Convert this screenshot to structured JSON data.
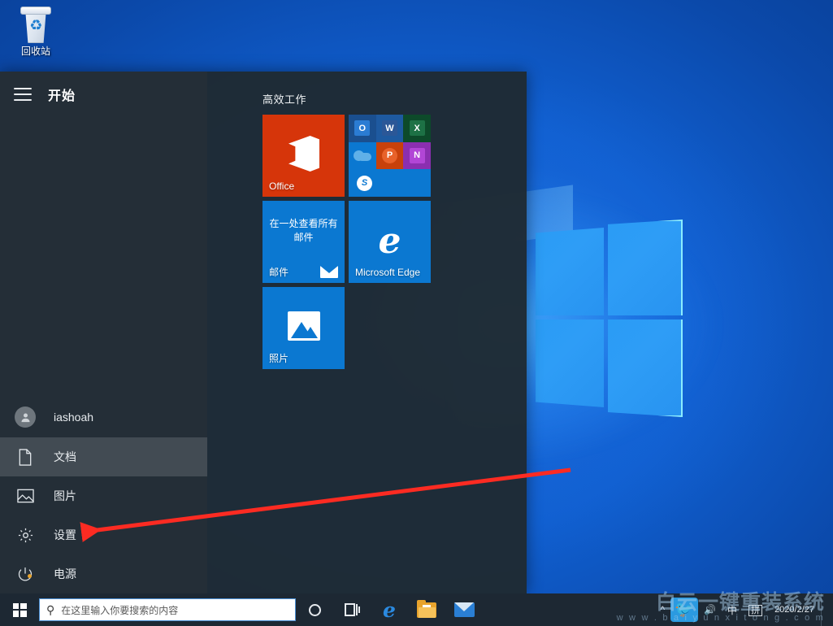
{
  "desktop": {
    "recycle_bin_label": "回收站",
    "recycle_bin_icon": "recycle-bin-icon"
  },
  "start_menu": {
    "hamburger_icon": "hamburger-menu-icon",
    "title": "开始",
    "user": {
      "name": "iashoah",
      "avatar_icon": "user-avatar-icon"
    },
    "rail_items": [
      {
        "label": "文档",
        "icon": "document-icon",
        "selected": true
      },
      {
        "label": "图片",
        "icon": "picture-icon",
        "selected": false
      },
      {
        "label": "设置",
        "icon": "gear-icon",
        "selected": false
      },
      {
        "label": "电源",
        "icon": "power-icon",
        "selected": false
      }
    ],
    "tile_group": {
      "title": "高效工作",
      "tiles": [
        {
          "name": "office",
          "label": "Office",
          "color": "#d6350a"
        },
        {
          "name": "suite",
          "label": "",
          "color": "#0b78d1"
        },
        {
          "name": "mail",
          "label": "邮件",
          "headline": "在一处查看所有邮件",
          "color": "#0b78d1"
        },
        {
          "name": "edge",
          "label": "Microsoft Edge",
          "color": "#0b78d1"
        },
        {
          "name": "photos",
          "label": "照片",
          "color": "#0b78d1"
        }
      ],
      "suite_apps": [
        {
          "key": "O",
          "name": "outlook-icon"
        },
        {
          "key": "W",
          "name": "word-icon"
        },
        {
          "key": "X",
          "name": "excel-icon"
        },
        {
          "key": "",
          "name": "onedrive-icon"
        },
        {
          "key": "P",
          "name": "powerpoint-icon"
        },
        {
          "key": "N",
          "name": "onenote-icon"
        },
        {
          "key": "S",
          "name": "skype-icon"
        }
      ]
    }
  },
  "annotation": {
    "arrow_color": "#fc2b22",
    "points_to": "设置"
  },
  "taskbar": {
    "start_button_icon": "windows-logo-icon",
    "search": {
      "placeholder": "在这里输入你要搜索的内容",
      "icon": "search-icon",
      "value": ""
    },
    "buttons": [
      {
        "name": "cortana-button",
        "icon": "cortana-circle-icon"
      },
      {
        "name": "task-view-button",
        "icon": "task-view-icon"
      },
      {
        "name": "edge-button",
        "icon": "edge-icon"
      },
      {
        "name": "file-explorer-button",
        "icon": "folder-icon"
      },
      {
        "name": "mail-button",
        "icon": "envelope-icon"
      }
    ],
    "tray": {
      "overflow_icon": "chevron-up-icon",
      "twitter_icon": "twitter-icon",
      "volume_icon": "speaker-icon",
      "ime_mode": "中",
      "ime_pinyin": "拼",
      "date": "2020/2/27",
      "time": "",
      "show_desktop": "show-desktop-button"
    }
  },
  "watermark": {
    "main": "白云一键重装系统",
    "sub": "w w w . b a i y u n x i t o n g . c o m"
  }
}
